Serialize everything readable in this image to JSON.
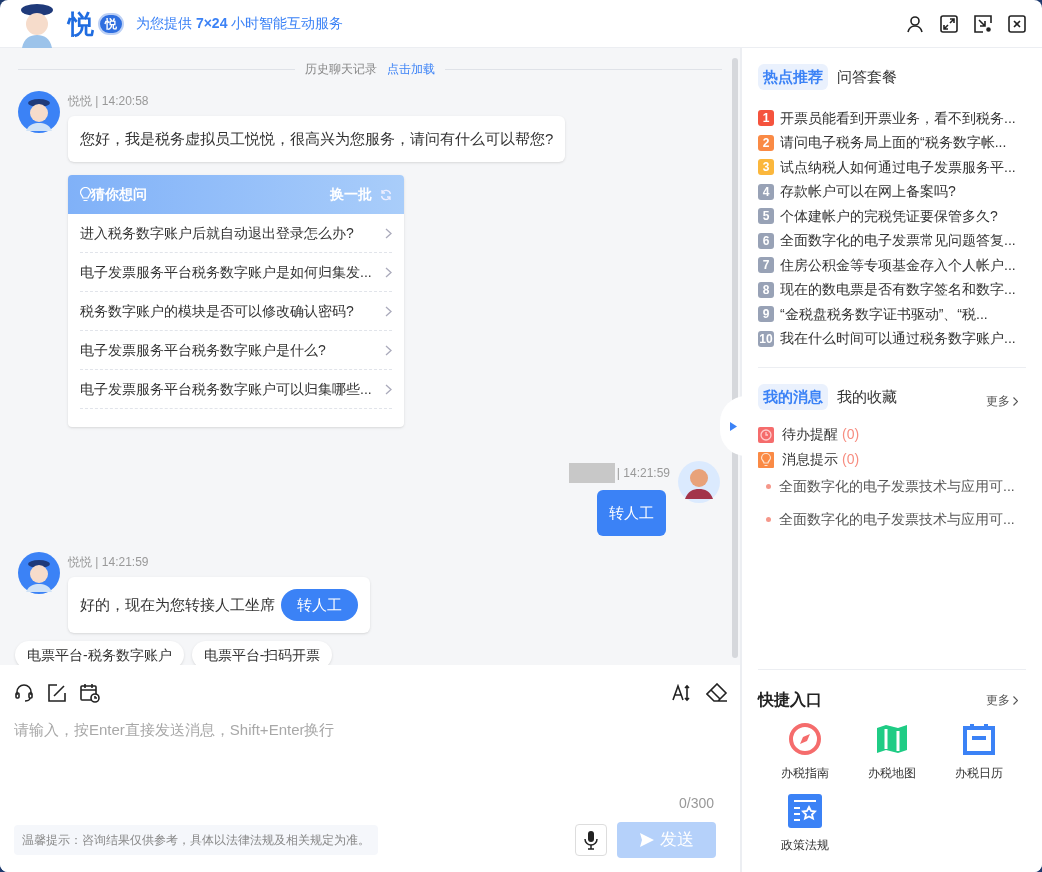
{
  "header": {
    "brand": "悦",
    "badge": "悦",
    "slogan": "为您提供 **7×24** 小时智能互动服务"
  },
  "chat": {
    "history": {
      "label": "历史聊天记录",
      "link": "点击加载"
    },
    "messages": [
      {
        "kind": "bot_text",
        "meta": "悦悦 | 14:20:58",
        "text": "您好，我是税务虚拟员工悦悦，很高兴为您服务，请问有什么可以帮您?"
      },
      {
        "kind": "suggestions",
        "title": "猜你想问",
        "refresh": "换一批",
        "items": [
          "进入税务数字账户后就自动退出登录怎么办?",
          "电子发票服务平台税务数字账户是如何归集发...",
          "税务数字账户的模块是否可以修改确认密码?",
          "电子发票服务平台税务数字账户是什么?",
          "电子发票服务平台税务数字账户可以归集哪些..."
        ]
      },
      {
        "kind": "user_text",
        "meta": "| 14:21:59",
        "text": "转人工"
      },
      {
        "kind": "bot_action",
        "meta": "悦悦 | 14:21:59",
        "text": "好的，现在为您转接人工坐席",
        "button": "转人工"
      }
    ],
    "quick_tags": [
      "电票平台-税务数字账户",
      "电票平台-扫码开票"
    ]
  },
  "composer": {
    "placeholder": "请输入，按Enter直接发送消息，Shift+Enter换行",
    "counter": "0/300",
    "tip": "温馨提示：咨询结果仅供参考，具体以法律法规及相关规定为准。",
    "send": "发送",
    "send_disabled": true
  },
  "side": {
    "hot_tabs": [
      {
        "label": "热点推荐",
        "selected": true
      },
      {
        "label": "问答套餐",
        "selected": false
      }
    ],
    "hot_items": [
      {
        "rank": "1",
        "color": "#f5533d",
        "text": "开票员能看到开票业务，看不到税务..."
      },
      {
        "rank": "2",
        "color": "#fa8a45",
        "text": "请问电子税务局上面的“税务数字帐..."
      },
      {
        "rank": "3",
        "color": "#fbb73c",
        "text": "试点纳税人如何通过电子发票服务平..."
      },
      {
        "rank": "4",
        "color": "#98a2b6",
        "text": "存款帐户可以在网上备案吗?"
      },
      {
        "rank": "5",
        "color": "#98a2b6",
        "text": "个体建帐户的完税凭证要保管多久?"
      },
      {
        "rank": "6",
        "color": "#98a2b6",
        "text": "全面数字化的电子发票常见问题答复..."
      },
      {
        "rank": "7",
        "color": "#98a2b6",
        "text": "住房公积金等专项基金存入个人帐户..."
      },
      {
        "rank": "8",
        "color": "#98a2b6",
        "text": "现在的数电票是否有数字签名和数字..."
      },
      {
        "rank": "9",
        "color": "#98a2b6",
        "text": "“金税盘税务数字证书驱动”、“税..."
      },
      {
        "rank": "10",
        "color": "#98a2b6",
        "text": "我在什么时间可以通过税务数字账户..."
      }
    ],
    "msg_tabs": [
      {
        "label": "我的消息",
        "selected": true
      },
      {
        "label": "我的收藏",
        "selected": false
      }
    ],
    "msg_more": "更多",
    "reminders": [
      {
        "kind": "todo",
        "label": "待办提醒",
        "count": "(0)"
      },
      {
        "kind": "notice",
        "label": "消息提示",
        "count": "(0)"
      }
    ],
    "notices": [
      "全面数字化的电子发票技术与应用可...",
      "全面数字化的电子发票技术与应用可..."
    ],
    "quick_title": "快捷入口",
    "quick_more": "更多",
    "quick": [
      {
        "kind": "guide",
        "label": "办税指南"
      },
      {
        "kind": "map",
        "label": "办税地图"
      },
      {
        "kind": "calendar",
        "label": "办税日历"
      },
      {
        "kind": "policy",
        "label": "政策法规"
      }
    ]
  }
}
